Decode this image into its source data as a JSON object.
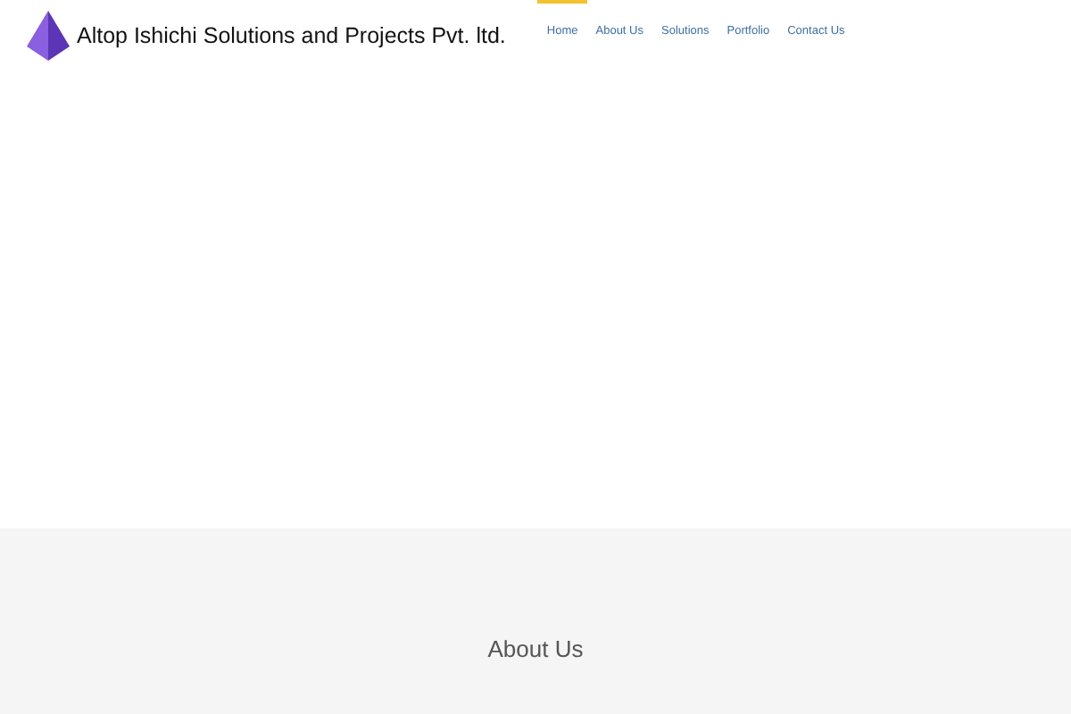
{
  "header": {
    "brand": "Altop Ishichi Solutions and Projects Pvt. ltd."
  },
  "nav": [
    {
      "label": "Home",
      "selected": true
    },
    {
      "label": "About Us",
      "selected": false
    },
    {
      "label": "Solutions",
      "selected": false
    },
    {
      "label": "Portfolio",
      "selected": false
    },
    {
      "label": "Contact Us",
      "selected": false
    }
  ],
  "about": {
    "heading": "About Us"
  }
}
